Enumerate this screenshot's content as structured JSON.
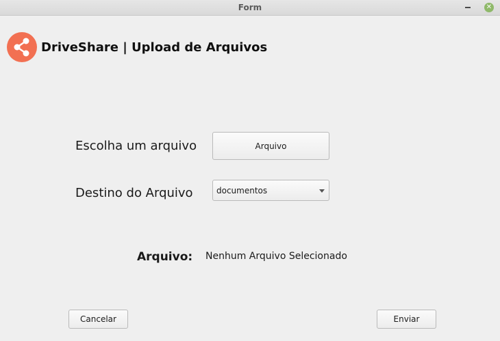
{
  "window": {
    "title": "Form",
    "minimize_icon": "minimize-icon",
    "close_icon": "close-icon"
  },
  "header": {
    "icon": "share-icon",
    "icon_color": "#f27052",
    "title": "DriveShare | Upload de Arquivos"
  },
  "form": {
    "file_label": "Escolha um arquivo",
    "file_button_label": "Arquivo",
    "destination_label": "Destino do Arquivo",
    "destination_selected": "documentos"
  },
  "status": {
    "label": "Arquivo:",
    "value": "Nenhum Arquivo Selecionado"
  },
  "footer": {
    "cancel_label": "Cancelar",
    "submit_label": "Enviar"
  }
}
